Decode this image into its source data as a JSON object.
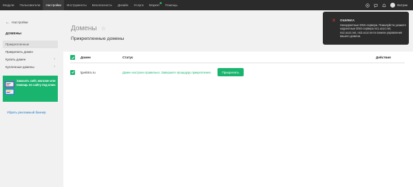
{
  "topnav": {
    "items": [
      {
        "label": "Модули"
      },
      {
        "label": "Пользователи"
      },
      {
        "label": "Настройки"
      },
      {
        "label": "Инструменты"
      },
      {
        "label": "Безопасность"
      },
      {
        "label": "Дизайн"
      },
      {
        "label": "Услуги"
      },
      {
        "label": "Маркет"
      },
      {
        "label": "Помощь"
      }
    ],
    "active_index": 2,
    "user_name": "Витрак",
    "icons": [
      "plus-circle-icon",
      "chat-icon",
      "bell-icon",
      "avatar"
    ]
  },
  "sidebar": {
    "back_label": "Настройки",
    "section_title": "ДОМЕНЫ",
    "items": [
      {
        "label": "Прикрепленные",
        "selected": true
      },
      {
        "label": "Прикрепить домен"
      },
      {
        "label": "Купить домен",
        "chevron": "›"
      },
      {
        "label": "Купленные домены",
        "chevron": "›"
      }
    ],
    "promo_text": "Заказать сайт, магазин или помощь по сайту под ключ",
    "promo_remove": "Убрать рекламный баннер"
  },
  "main": {
    "title": "Домены",
    "star": "☆",
    "subtitle": "Прикрепленные домены",
    "table": {
      "headers": {
        "domain": "Домен",
        "status": "Статус",
        "actions": "Действия"
      },
      "rows": [
        {
          "domain": "lgvebtro.ru",
          "status": "Домен настроен правильно. Завершите процедуру прикрепления.",
          "action": "Прикрепить"
        }
      ]
    }
  },
  "toast": {
    "title": "ОШИБКА",
    "message": "Некорректные DNS-сервера. Пожалуйста укажите корректные DNS-сервера ns1.ucoz.net, ns2.ucoz.net, ns3.ucoz.net в панели управления вашего домена.",
    "accent": "#e53935"
  },
  "colors": {
    "brand_green": "#19b46e",
    "nav_bg": "#2b2b2b",
    "link_blue": "#1a73c8"
  }
}
